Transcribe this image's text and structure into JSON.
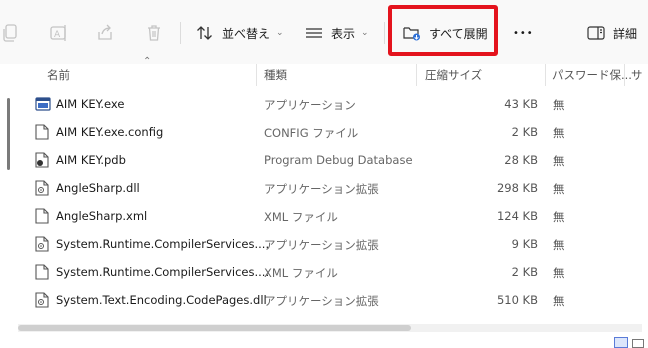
{
  "toolbar": {
    "sort_label": "並べ替え",
    "view_label": "表示",
    "extract_all_label": "すべて展開",
    "more_label": "•••",
    "details_label": "詳細"
  },
  "columns": {
    "name": "名前",
    "type": "種類",
    "compressed_size": "圧縮サイズ",
    "password": "パスワード保...",
    "size": "サ"
  },
  "files": [
    {
      "name": "AIM KEY.exe",
      "type": "アプリケーション",
      "size": "43 KB",
      "password": "無",
      "icon": "exe-icon"
    },
    {
      "name": "AIM KEY.exe.config",
      "type": "CONFIG ファイル",
      "size": "2 KB",
      "password": "無",
      "icon": "file-icon"
    },
    {
      "name": "AIM KEY.pdb",
      "type": "Program Debug Database",
      "size": "28 KB",
      "password": "無",
      "icon": "pdb-icon"
    },
    {
      "name": "AngleSharp.dll",
      "type": "アプリケーション拡張",
      "size": "298 KB",
      "password": "無",
      "icon": "dll-icon"
    },
    {
      "name": "AngleSharp.xml",
      "type": "XML ファイル",
      "size": "124 KB",
      "password": "無",
      "icon": "file-icon"
    },
    {
      "name": "System.Runtime.CompilerServices....",
      "type": "アプリケーション拡張",
      "size": "9 KB",
      "password": "無",
      "icon": "dll-icon"
    },
    {
      "name": "System.Runtime.CompilerServices....",
      "type": "XML ファイル",
      "size": "2 KB",
      "password": "無",
      "icon": "file-icon"
    },
    {
      "name": "System.Text.Encoding.CodePages.dll",
      "type": "アプリケーション拡張",
      "size": "510 KB",
      "password": "無",
      "icon": "dll-icon"
    }
  ],
  "colors": {
    "highlight": "#e4131d",
    "toolbar_bg": "#f9f9f9"
  }
}
